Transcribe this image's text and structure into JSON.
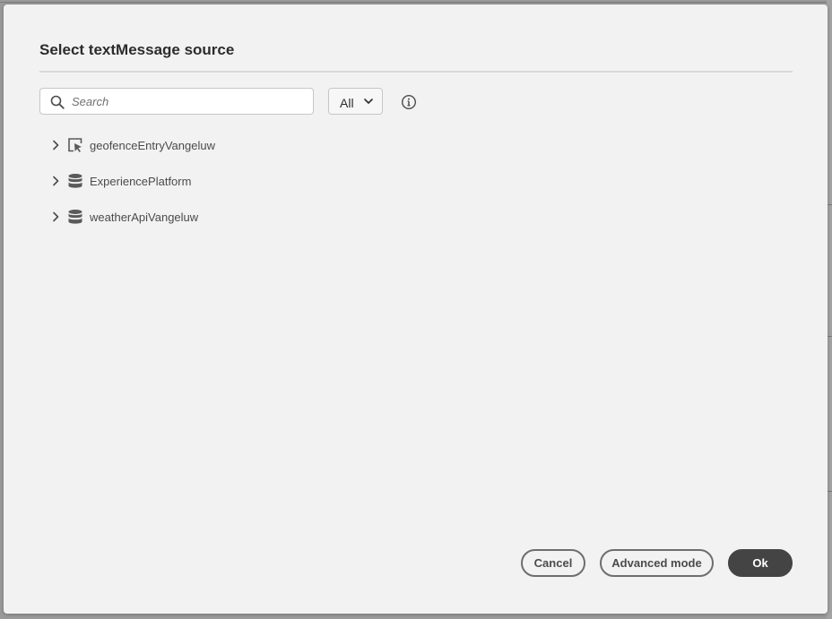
{
  "dialog": {
    "title": "Select textMessage source"
  },
  "search": {
    "placeholder": "Search",
    "value": ""
  },
  "filter": {
    "selected": "All"
  },
  "tree": {
    "items": [
      {
        "label": "geofenceEntryVangeluw",
        "icon": "event-icon",
        "expanded": false
      },
      {
        "label": "ExperiencePlatform",
        "icon": "database-icon",
        "expanded": false
      },
      {
        "label": "weatherApiVangeluw",
        "icon": "database-icon",
        "expanded": false
      }
    ]
  },
  "buttons": {
    "cancel": "Cancel",
    "advanced": "Advanced mode",
    "ok": "Ok"
  },
  "colors": {
    "primary_button": "#444444",
    "dialog_bg": "#f2f2f2",
    "text": "#2c2c2c"
  }
}
